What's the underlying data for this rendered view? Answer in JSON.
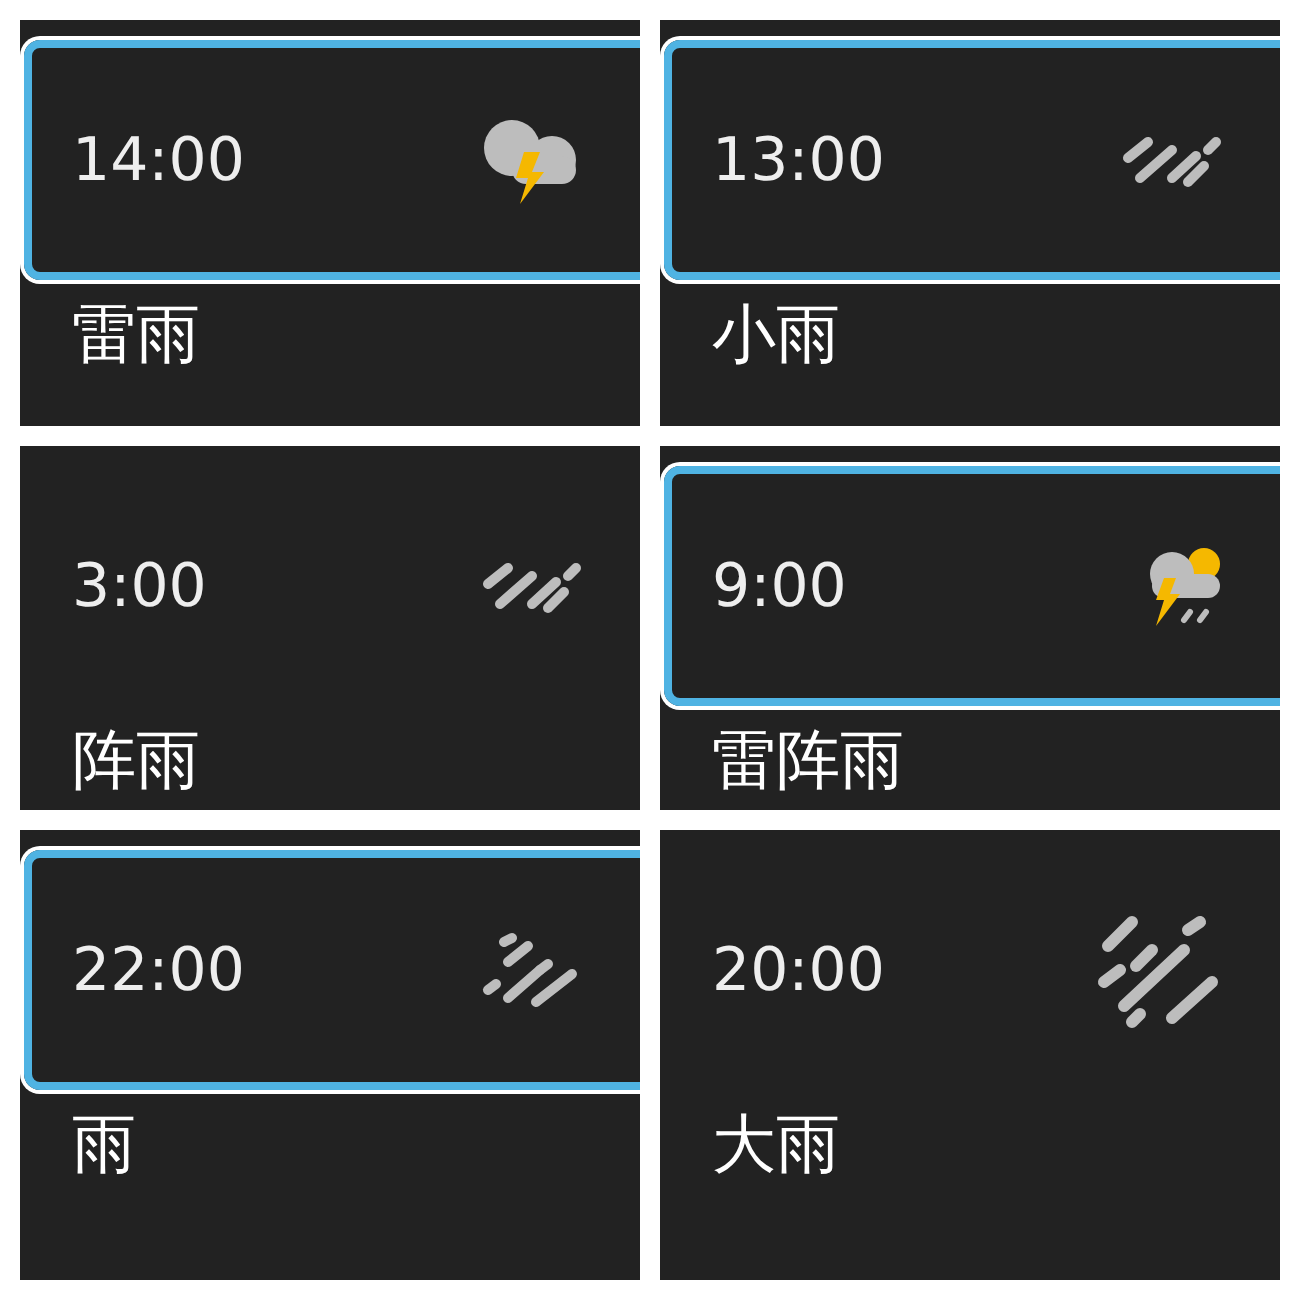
{
  "panels": [
    {
      "time": "14:00",
      "kind": "thunder-cloud",
      "condition": "雷雨",
      "selected": true
    },
    {
      "time": "13:00",
      "kind": "light-rain",
      "condition": "小雨",
      "selected": true
    },
    {
      "time": "3:00",
      "kind": "light-rain",
      "condition": "阵雨",
      "selected": false
    },
    {
      "time": "9:00",
      "kind": "thunder-shower",
      "condition": "雷阵雨",
      "selected": true
    },
    {
      "time": "22:00",
      "kind": "rain",
      "condition": "雨",
      "selected": true
    },
    {
      "time": "20:00",
      "kind": "heavy-rain",
      "condition": "大雨",
      "selected": false
    }
  ]
}
